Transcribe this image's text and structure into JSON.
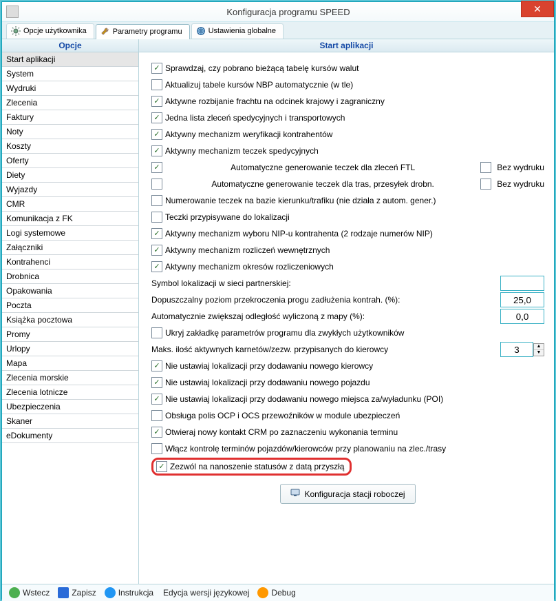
{
  "window": {
    "title": "Konfiguracja programu SPEED"
  },
  "tabs": {
    "user": "Opcje użytkownika",
    "params": "Parametry programu",
    "global": "Ustawienia globalne"
  },
  "left": {
    "header": "Opcje",
    "items": [
      "Start aplikacji",
      "System",
      "Wydruki",
      "Zlecenia",
      "Faktury",
      "Noty",
      "Koszty",
      "Oferty",
      "Diety",
      "Wyjazdy",
      "CMR",
      "Komunikacja z FK",
      "Logi systemowe",
      "Załączniki",
      "Kontrahenci",
      "Drobnica",
      "Opakowania",
      "Poczta",
      "Książka pocztowa",
      "Promy",
      "Urlopy",
      "Mapa",
      "Zlecenia morskie",
      "Zlecenia lotnicze",
      "Ubezpieczenia",
      "Skaner",
      "eDokumenty"
    ],
    "selected_index": 0
  },
  "right": {
    "header": "Start aplikacji",
    "rows": [
      {
        "t": "check",
        "checked": true,
        "label": "Sprawdzaj, czy pobrano bieżącą tabelę kursów walut"
      },
      {
        "t": "check",
        "checked": false,
        "label": "Aktualizuj tabele kursów NBP automatycznie (w tle)"
      },
      {
        "t": "check",
        "checked": true,
        "label": "Aktywne rozbijanie frachtu na odcinek krajowy i zagraniczny"
      },
      {
        "t": "check",
        "checked": true,
        "label": "Jedna lista zleceń spedycyjnych i transportowych"
      },
      {
        "t": "check",
        "checked": true,
        "label": "Aktywny mechanizm weryfikacji kontrahentów"
      },
      {
        "t": "check",
        "checked": true,
        "label": "Aktywny mechanizm teczek spedycyjnych"
      },
      {
        "t": "check_side",
        "checked": true,
        "label": "Automatyczne generowanie teczek dla zleceń FTL",
        "side_checked": false,
        "side_label": "Bez wydruku"
      },
      {
        "t": "check_side",
        "checked": false,
        "label": "Automatyczne generowanie teczek dla tras, przesyłek drobn.",
        "side_checked": false,
        "side_label": "Bez wydruku"
      },
      {
        "t": "check",
        "checked": false,
        "label": "Numerowanie teczek na bazie kierunku/trafiku (nie działa z autom. gener.)"
      },
      {
        "t": "check",
        "checked": false,
        "label": "Teczki przypisywane do lokalizacji"
      },
      {
        "t": "check",
        "checked": true,
        "label": "Aktywny mechanizm wyboru NIP-u kontrahenta (2 rodzaje numerów NIP)"
      },
      {
        "t": "check",
        "checked": true,
        "label": "Aktywny mechanizm rozliczeń wewnętrznych"
      },
      {
        "t": "check",
        "checked": true,
        "label": "Aktywny mechanizm okresów rozliczeniowych"
      },
      {
        "t": "label_input",
        "label": "Symbol lokalizacji w sieci partnerskiej:",
        "value": ""
      },
      {
        "t": "label_input",
        "label": "Dopuszczalny poziom przekroczenia progu zadłużenia kontrah. (%):",
        "value": "25,0"
      },
      {
        "t": "label_input",
        "label": "Automatycznie zwiększaj odległość wyliczoną z mapy (%):",
        "value": "0,0"
      },
      {
        "t": "check",
        "checked": false,
        "label": "Ukryj zakładkę parametrów programu dla zwykłych użytkowników"
      },
      {
        "t": "label_spin",
        "label": "Maks. ilość aktywnych karnetów/zezw. przypisanych do kierowcy",
        "value": "3"
      },
      {
        "t": "check",
        "checked": true,
        "label": "Nie ustawiaj lokalizacji przy dodawaniu nowego kierowcy"
      },
      {
        "t": "check",
        "checked": true,
        "label": "Nie ustawiaj lokalizacji przy dodawaniu nowego pojazdu"
      },
      {
        "t": "check",
        "checked": true,
        "label": "Nie ustawiaj lokalizacji przy dodawaniu nowego miejsca za/wyładunku (POI)"
      },
      {
        "t": "check",
        "checked": false,
        "label": "Obsługa polis OCP i OCS przewoźników w module ubezpieczeń"
      },
      {
        "t": "check",
        "checked": true,
        "label": "Otwieraj nowy kontakt CRM po zaznaczeniu wykonania terminu"
      },
      {
        "t": "check",
        "checked": false,
        "label": "Włącz kontrolę terminów pojazdów/kierowców przy planowaniu na zlec./trasy"
      },
      {
        "t": "check_hl",
        "checked": true,
        "label": "Zezwól na nanoszenie statusów z datą przyszłą"
      }
    ],
    "config_button": "Konfiguracja stacji roboczej"
  },
  "footer": {
    "back": "Wstecz",
    "save": "Zapisz",
    "info": "Instrukcja",
    "lang": "Edycja wersji językowej",
    "debug": "Debug"
  }
}
